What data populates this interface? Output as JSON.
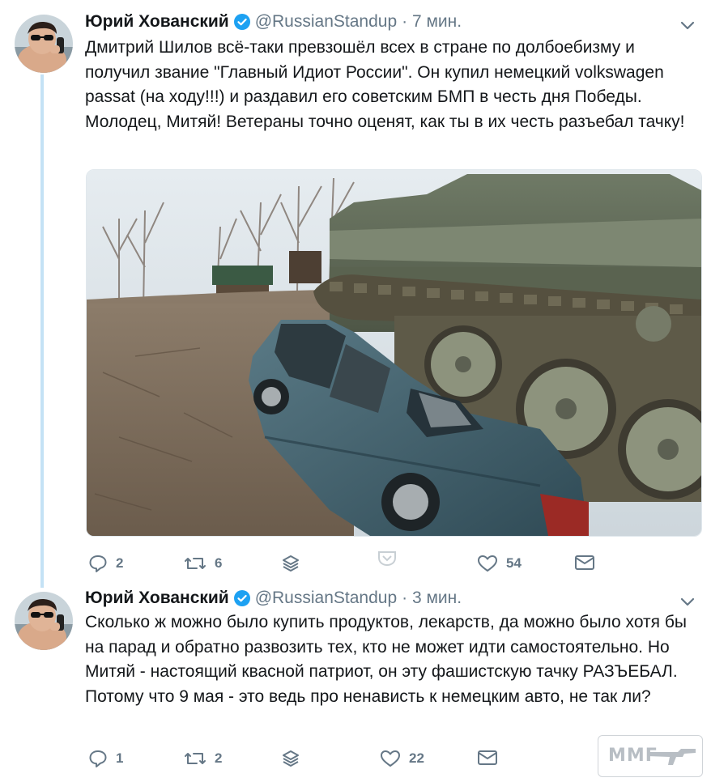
{
  "tweets": [
    {
      "author_name": "Юрий Хованский",
      "handle": "@RussianStandup",
      "time": "· 7 мин.",
      "text": "Дмитрий Шилов всё-таки превзошёл всех в стране по долбоебизму и получил звание \"Главный Идиот России\". Он купил немецкий volkswagen passat (на ходу!!!) и раздавил его советским БМП в честь дня Победы. Молодец, Митяй! Ветераны точно оценят, как ты в их честь разъебал тачку!",
      "replies": "2",
      "retweets": "6",
      "likes": "54"
    },
    {
      "author_name": "Юрий Хованский",
      "handle": "@RussianStandup",
      "time": "· 3 мин.",
      "text": "Сколько ж можно было купить продуктов, лекарств, да можно было хотя бы на парад и обратно развозить тех, кто не может идти самостоятельно. Но Митяй - настоящий квасной патриот, он эту фашистскую тачку РАЗЪЕБАЛ. Потому что 9 мая - это ведь про ненависть к немецким авто, не так ли?",
      "replies": "1",
      "retweets": "2",
      "likes": "22"
    }
  ],
  "icons": {
    "verified": "verified-badge-icon",
    "more": "chevron-down-icon",
    "reply": "reply-icon",
    "retweet": "retweet-icon",
    "stack": "stack-icon",
    "like": "heart-icon",
    "dm": "envelope-icon"
  },
  "colors": {
    "accent": "#1da1f2",
    "thread_line": "#c4e2f5",
    "secondary_text": "#657786"
  },
  "watermark": "ММГ"
}
